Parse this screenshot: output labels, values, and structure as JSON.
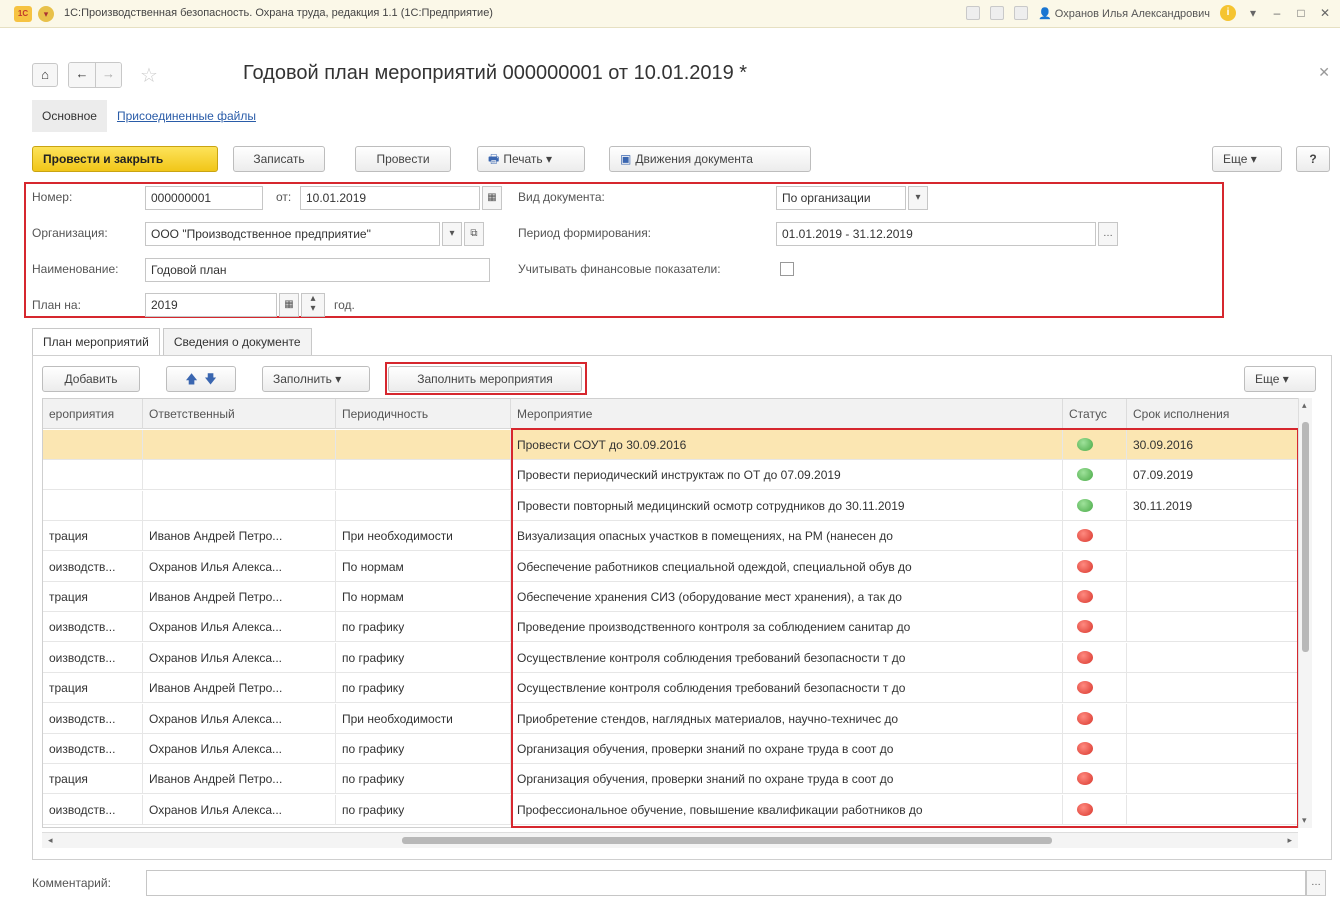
{
  "window": {
    "title": "1С:Производственная безопасность. Охрана труда, редакция 1.1  (1С:Предприятие)",
    "user": "Охранов Илья Александрович"
  },
  "document": {
    "title": "Годовой план мероприятий 000000001 от 10.01.2019 *"
  },
  "top_tabs": {
    "main": "Основное",
    "files": "Присоединенные файлы"
  },
  "toolbar": {
    "post_close": "Провести и закрыть",
    "save": "Записать",
    "post": "Провести",
    "print": "Печать",
    "movements": "Движения документа",
    "more": "Еще",
    "help": "?"
  },
  "form": {
    "number_label": "Номер:",
    "number_value": "000000001",
    "date_label": "от:",
    "date_value": "10.01.2019",
    "doctype_label": "Вид документа:",
    "doctype_value": "По организации",
    "org_label": "Организация:",
    "org_value": "ООО \"Производственное предприятие\"",
    "period_label": "Период формирования:",
    "period_value": "01.01.2019 - 31.12.2019",
    "name_label": "Наименование:",
    "name_value": "Годовой план",
    "finance_label": "Учитывать финансовые показатели:",
    "plan_label": "План на:",
    "plan_value": "2019",
    "plan_unit": "год."
  },
  "inner_tabs": {
    "plan": "План мероприятий",
    "info": "Сведения о документе"
  },
  "grid_toolbar": {
    "add": "Добавить",
    "fill": "Заполнить",
    "fill_events": "Заполнить мероприятия",
    "more": "Еще"
  },
  "grid": {
    "columns": [
      "ероприятия",
      "Ответственный",
      "Периодичность",
      "Мероприятие",
      "Статус",
      "Срок исполнения"
    ],
    "rows": [
      {
        "dept": "",
        "resp": "",
        "period": "",
        "event": "Провести СОУТ до 30.09.2016",
        "status": "green",
        "due": "30.09.2016"
      },
      {
        "dept": "",
        "resp": "",
        "period": "",
        "event": "Провести периодический инструктаж по ОТ до 07.09.2019",
        "status": "green",
        "due": "07.09.2019"
      },
      {
        "dept": "",
        "resp": "",
        "period": "",
        "event": "Провести повторный медицинский осмотр сотрудников до 30.11.2019",
        "status": "green",
        "due": "30.11.2019"
      },
      {
        "dept": "трация",
        "resp": "Иванов Андрей Петро...",
        "period": "При необходимости",
        "event": "Визуализация опасных участков  в помещениях, на РМ  (нанесен до",
        "status": "red",
        "due": ""
      },
      {
        "dept": "оизводств...",
        "resp": "Охранов Илья Алекса...",
        "period": "По нормам",
        "event": "Обеспечение работников специальной одеждой, специальной обув до",
        "status": "red",
        "due": ""
      },
      {
        "dept": "трация",
        "resp": "Иванов Андрей Петро...",
        "period": "По нормам",
        "event": "Обеспечение хранения СИЗ (оборудование мест хранения), а так до",
        "status": "red",
        "due": ""
      },
      {
        "dept": "оизводств...",
        "resp": "Охранов Илья Алекса...",
        "period": "по графику",
        "event": "Проведение производственного контроля за соблюдением санитар до",
        "status": "red",
        "due": ""
      },
      {
        "dept": "оизводств...",
        "resp": "Охранов Илья Алекса...",
        "period": "по графику",
        "event": "Осуществление контроля  соблюдения требований безопасности т до",
        "status": "red",
        "due": ""
      },
      {
        "dept": "трация",
        "resp": "Иванов Андрей Петро...",
        "period": "по графику",
        "event": "Осуществление контроля  соблюдения требований безопасности т до",
        "status": "red",
        "due": ""
      },
      {
        "dept": "оизводств...",
        "resp": "Охранов Илья Алекса...",
        "period": "При необходимости",
        "event": "Приобретение стендов,  наглядных материалов, научно-техничес до",
        "status": "red",
        "due": ""
      },
      {
        "dept": "оизводств...",
        "resp": "Охранов Илья Алекса...",
        "period": "по графику",
        "event": "Организация обучения, проверки знаний по охране труда в соот до",
        "status": "red",
        "due": ""
      },
      {
        "dept": "трация",
        "resp": "Иванов Андрей Петро...",
        "period": "по графику",
        "event": "Организация обучения, проверки знаний по охране труда в соот до",
        "status": "red",
        "due": ""
      },
      {
        "dept": "оизводств...",
        "resp": "Охранов Илья Алекса...",
        "period": "по графику",
        "event": "Профессиональное обучение, повышение квалификации работников до",
        "status": "red",
        "due": ""
      }
    ]
  },
  "comment": {
    "label": "Комментарий:"
  }
}
